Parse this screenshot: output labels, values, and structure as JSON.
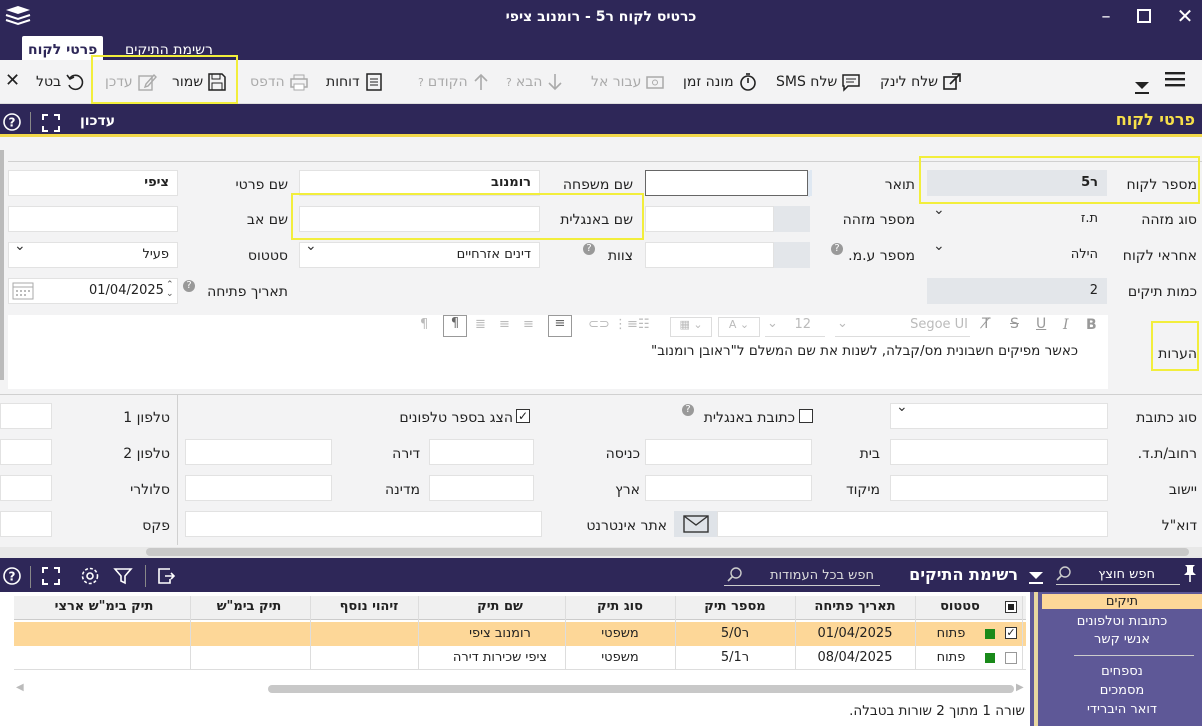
{
  "window": {
    "title": "כרטיס לקוח ר5 - רומנוב ציפי",
    "tabs": [
      "פרטי לקוח",
      "רשימת התיקים"
    ]
  },
  "toolbar": {
    "send_link": "שלח לינק",
    "send_sms": "שלח SMS",
    "timer": "מונה זמן",
    "goto": "עבור אל",
    "next": "הבא",
    "prev": "הקודם",
    "reports": "דוחות",
    "print": "הדפס",
    "save": "שמור",
    "update": "עדכן",
    "cancel": "בטל"
  },
  "section": {
    "title": "פרטי לקוח",
    "mode": "עדכון"
  },
  "form": {
    "customer_number_label": "מספר לקוח",
    "customer_number_value": "ר5",
    "title_label": "תואר",
    "title_value": "",
    "last_name_label": "שם משפחה",
    "last_name_value": "רומנוב",
    "first_name_label": "שם פרטי",
    "first_name_value": "ציפי",
    "id_type_label": "סוג מזהה",
    "id_type_value": "ת.ז",
    "id_number_label": "מספר מזהה",
    "english_name_label": "שם באנגלית",
    "father_name_label": "שם אב",
    "responsible_label": "אחראי לקוח",
    "responsible_value": "הילה",
    "vat_label": "מספר ע.מ.",
    "team_label": "צוות",
    "team_value": "דינים אזרחיים",
    "status_label": "סטטוס",
    "status_value": "פעיל",
    "cases_count_label": "כמות תיקים",
    "cases_count_value": "2",
    "open_date_label": "תאריך פתיחה",
    "open_date_value": "01/04/2025",
    "notes_label": "הערות",
    "notes_value": "כאשר מפיקים חשבונית מס/קבלה, לשנות את שם המשלם ל\"ראובן רומנוב\"",
    "font_name": "Segoe UI",
    "font_size": "12",
    "address_type_label": "סוג כתובת",
    "english_address_label": "כתובת באנגלית",
    "show_in_phonebook_label": "הצג בספר טלפונים",
    "phone1_label": "טלפון 1",
    "phone2_label": "טלפון 2",
    "mobile_label": "סלולרי",
    "fax_label": "פקס",
    "street_label": "רחוב/ת.ד.",
    "house_label": "בית",
    "entrance_label": "כניסה",
    "apartment_label": "דירה",
    "city_label": "יישוב",
    "zip_label": "מיקוד",
    "country_label": "ארץ",
    "state_label": "מדינה",
    "email_label": "דוא\"ל",
    "website_label": "אתר אינטרנט"
  },
  "cases": {
    "title": "רשימת התיקים",
    "search_placeholder": "חפש בכל העמודות",
    "columns": [
      "סטטוס",
      "תאריך פתיחה",
      "מספר תיק",
      "סוג תיק",
      "שם תיק",
      "זיהוי נוסף",
      "תיק בימ\"ש",
      "תיק בימ\"ש ארצי"
    ],
    "rows": [
      {
        "status": "פתוח",
        "date": "01/04/2025",
        "number": "ר5/0",
        "type": "משפטי",
        "name": "רומנוב ציפי"
      },
      {
        "status": "פתוח",
        "date": "08/04/2025",
        "number": "ר5/1",
        "type": "משפטי",
        "name": "ציפי שכירות דירה"
      }
    ],
    "footer": "שורה 1 מתוך 2 שורות בטבלה."
  },
  "sidebar": {
    "search_placeholder": "חפש חוצץ",
    "items": [
      "תיקים",
      "כתובות וטלפונים",
      "אנשי קשר",
      "נספחים",
      "מסמכים",
      "דואר היברידי"
    ]
  },
  "colors": {
    "header": "#2e2758",
    "highlight": "#f2ee3c",
    "selected_row": "#fdd798",
    "side_panel": "#5e5897",
    "status_green": "#1a8a1a"
  }
}
